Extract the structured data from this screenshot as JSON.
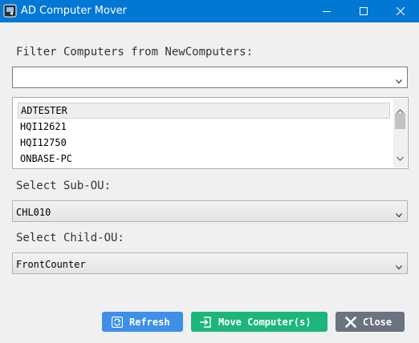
{
  "window": {
    "title": "AD Computer Mover",
    "controls": [
      "minimize-icon",
      "maximize-icon",
      "close-icon"
    ]
  },
  "filter": {
    "label": "Filter Computers from NewComputers:",
    "value": ""
  },
  "computers": {
    "items": [
      "ADTESTER",
      "HQI12621",
      "HQI12750",
      "ONBASE-PC"
    ],
    "selected_index": 0
  },
  "sub_ou": {
    "label": "Select Sub-OU:",
    "value": "CHL010"
  },
  "child_ou": {
    "label": "Select Child-OU:",
    "value": "FrontCounter"
  },
  "buttons": {
    "refresh": {
      "label": "Refresh",
      "icon": "refresh-icon",
      "color": "#3d8fe8"
    },
    "move": {
      "label": "Move Computer(s)",
      "icon": "move-arrow-icon",
      "color": "#1cb67c"
    },
    "close": {
      "label": "Close",
      "icon": "x-icon",
      "color": "#6b7380"
    }
  },
  "colors": {
    "titlebar": "#0078d4",
    "background": "#f0f0f0"
  }
}
